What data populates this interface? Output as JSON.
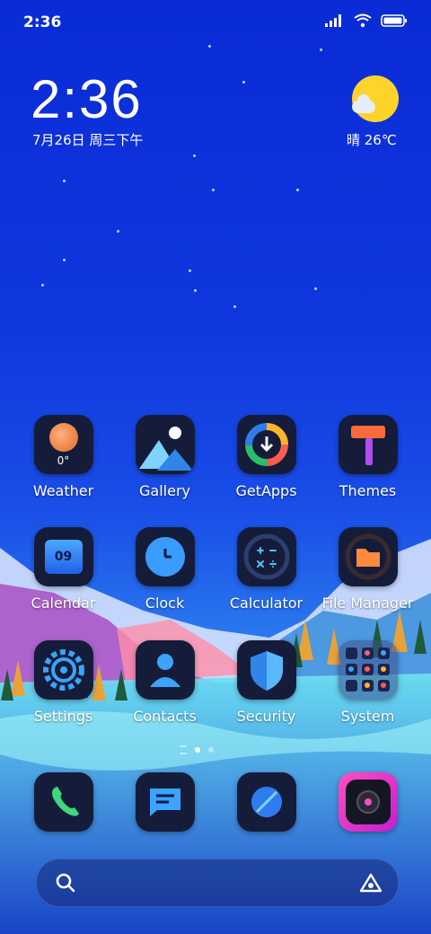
{
  "status_bar": {
    "time": "2:36"
  },
  "lock_widget": {
    "clock": "2:36",
    "date": "7月26日 周三下午",
    "weather": "晴 26℃"
  },
  "apps": [
    {
      "label": "Weather",
      "icon": "weather-icon",
      "badge": "0°"
    },
    {
      "label": "Gallery",
      "icon": "gallery-icon"
    },
    {
      "label": "GetApps",
      "icon": "getapps-icon"
    },
    {
      "label": "Themes",
      "icon": "themes-icon"
    },
    {
      "label": "Calendar",
      "icon": "calendar-icon",
      "badge": "09"
    },
    {
      "label": "Clock",
      "icon": "clock-icon"
    },
    {
      "label": "Calculator",
      "icon": "calculator-icon"
    },
    {
      "label": "File Manager",
      "icon": "file-manager-icon"
    },
    {
      "label": "Settings",
      "icon": "settings-icon"
    },
    {
      "label": "Contacts",
      "icon": "contacts-icon"
    },
    {
      "label": "Security",
      "icon": "security-icon"
    },
    {
      "label": "System",
      "icon": "folder-icon"
    }
  ],
  "dock": [
    {
      "icon": "phone-icon"
    },
    {
      "icon": "messages-icon"
    },
    {
      "icon": "browser-icon"
    },
    {
      "icon": "camera-icon"
    }
  ],
  "page_indicator": {
    "pages": 2,
    "current": 1
  },
  "colors": {
    "accent": "#1a3fe0",
    "sun": "#ffd42a"
  }
}
